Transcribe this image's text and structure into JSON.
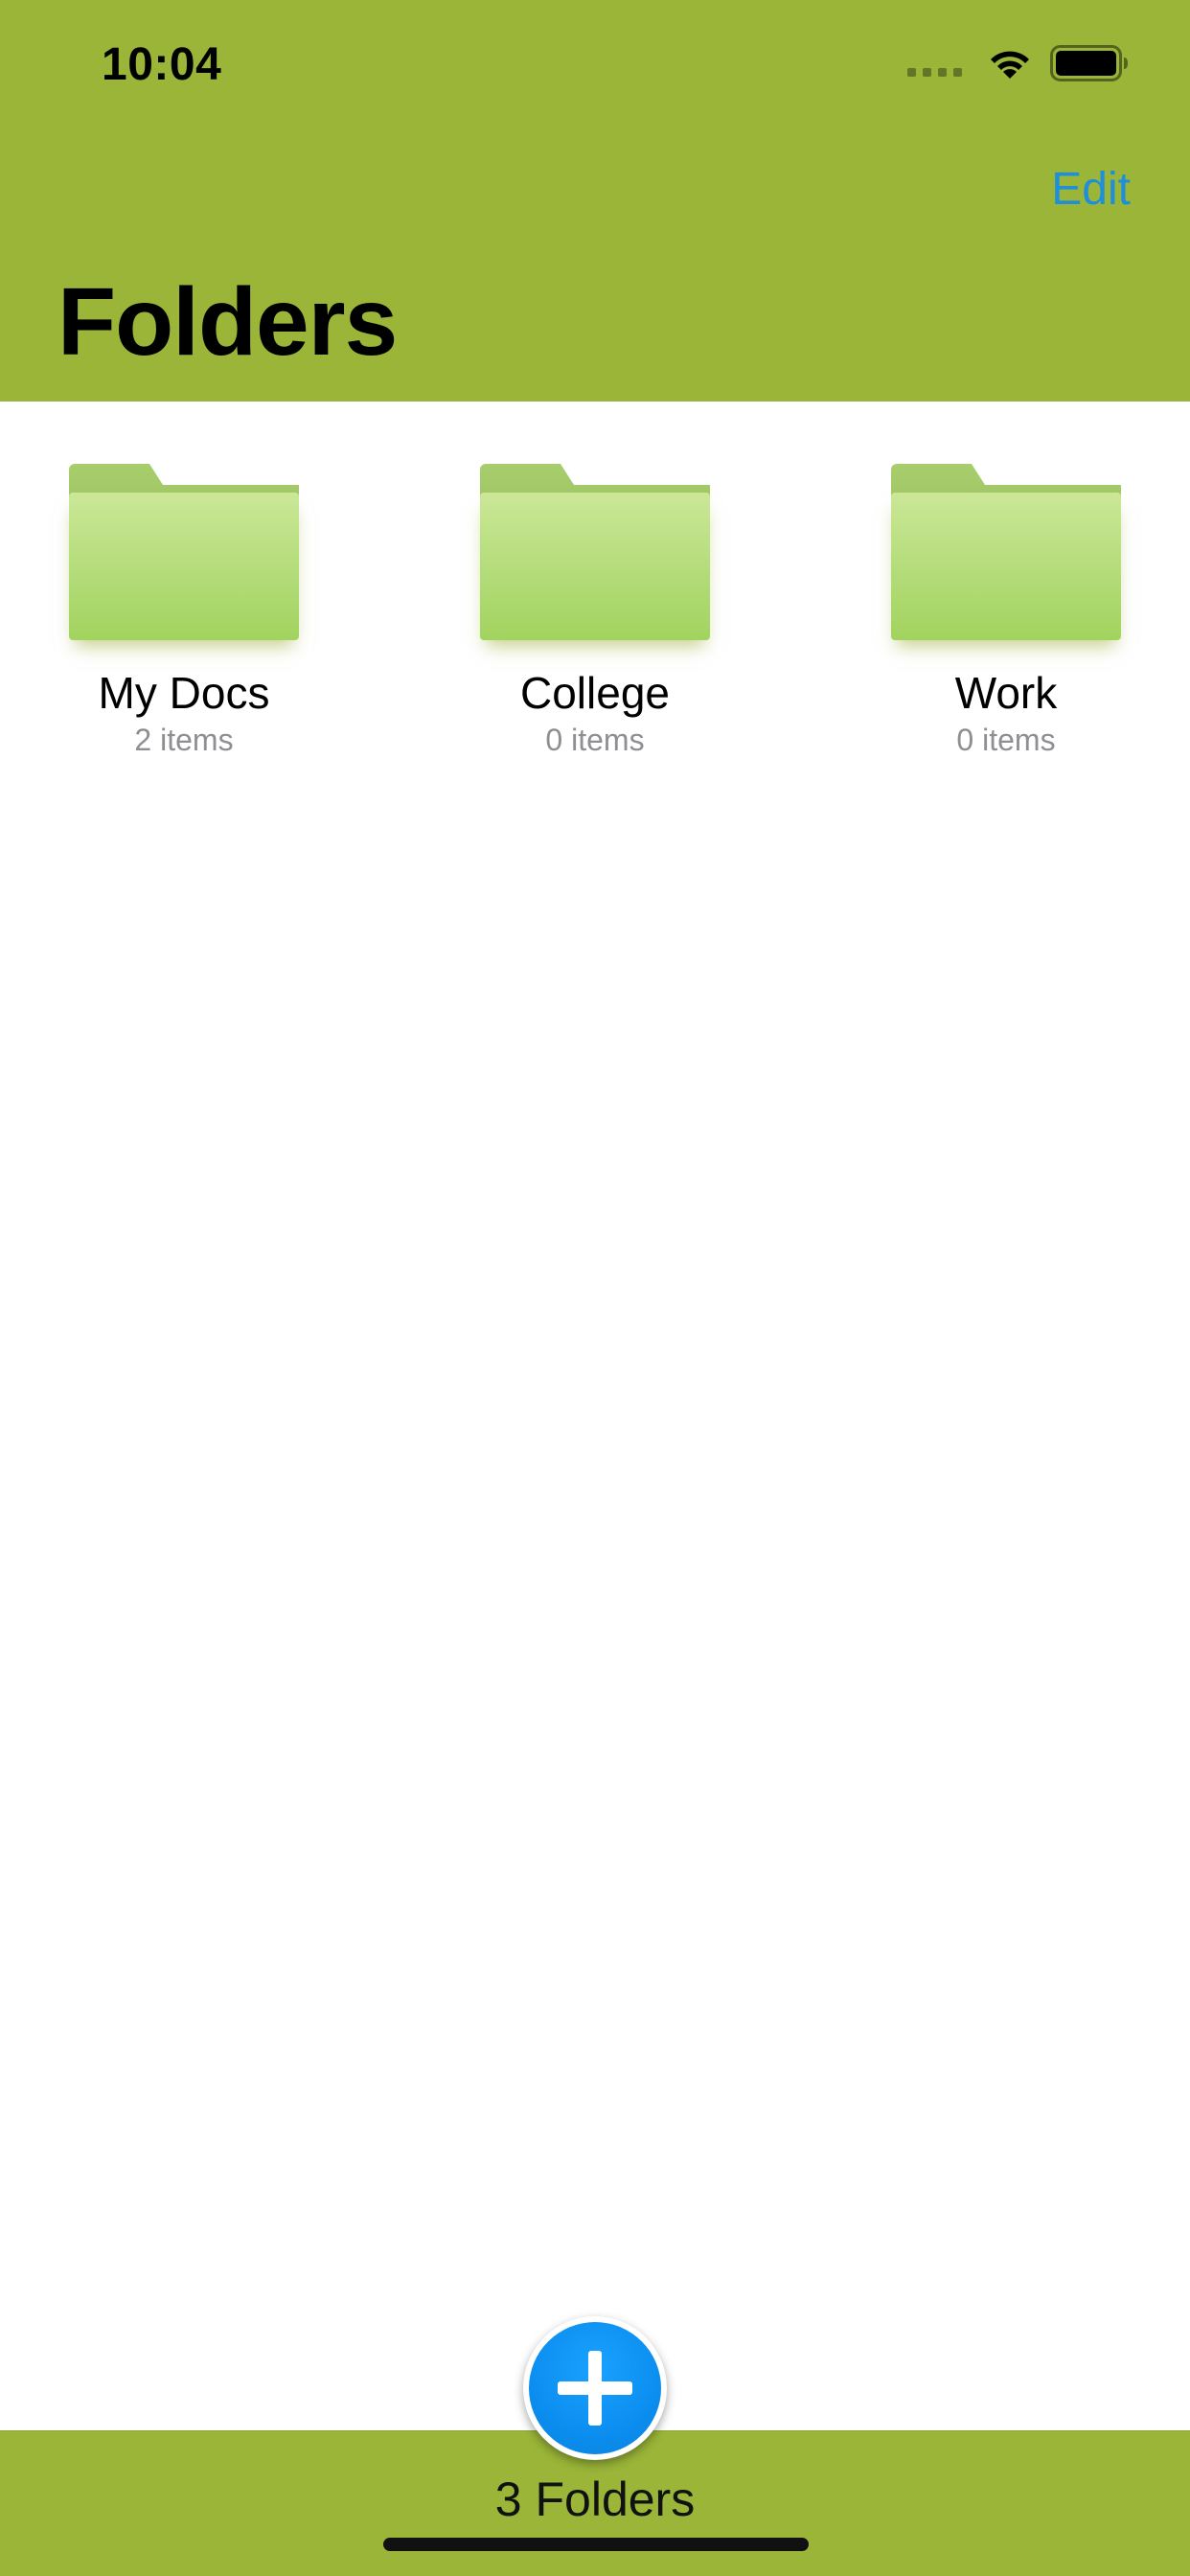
{
  "status_bar": {
    "time": "10:04",
    "signal_icon": "signal-dots-icon",
    "wifi_icon": "wifi-icon",
    "battery_icon": "battery-icon"
  },
  "header": {
    "edit_label": "Edit",
    "title": "Folders",
    "background_color": "#9ab538",
    "accent_color": "#1e8fd8"
  },
  "folders": [
    {
      "name": "My Docs",
      "count": "2 items",
      "icon": "folder-icon"
    },
    {
      "name": "College",
      "count": "0 items",
      "icon": "folder-icon"
    },
    {
      "name": "Work",
      "count": "0 items",
      "icon": "folder-icon"
    }
  ],
  "toolbar": {
    "add_icon": "plus-circle-icon",
    "summary": "3 Folders",
    "background_color": "#9ab538",
    "add_button_color": "#0b8ef0"
  }
}
